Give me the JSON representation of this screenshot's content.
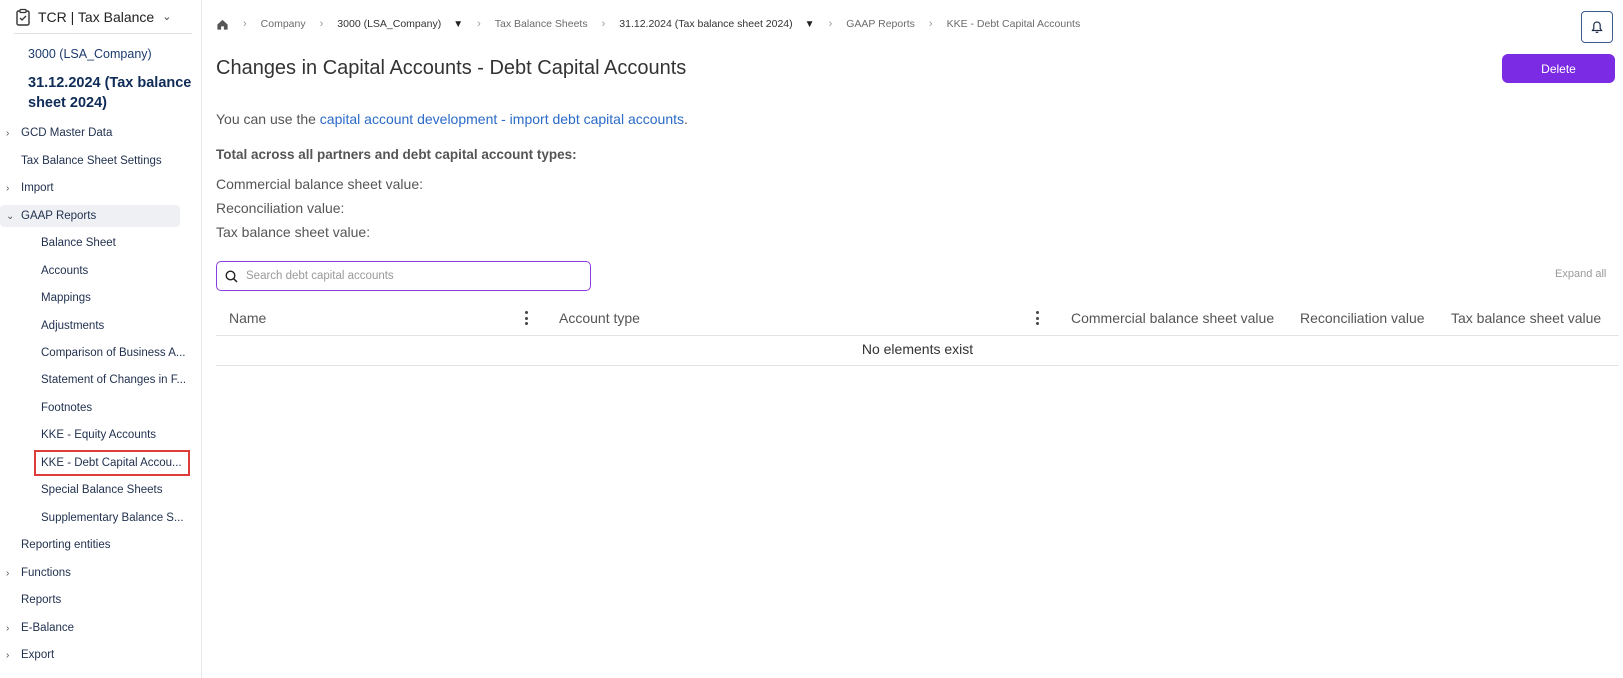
{
  "app": {
    "title": "TCR | Tax Balance"
  },
  "sidebar": {
    "company": "3000 (LSA_Company)",
    "sheet": "31.12.2024 (Tax balance sheet 2024)",
    "items": [
      {
        "label": "GCD Master Data",
        "expandable": true
      },
      {
        "label": "Tax Balance Sheet Settings",
        "expandable": false
      },
      {
        "label": "Import",
        "expandable": true
      },
      {
        "label": "GAAP Reports",
        "expandable": true,
        "expanded": true
      },
      {
        "label": "Balance Sheet"
      },
      {
        "label": "Accounts"
      },
      {
        "label": "Mappings"
      },
      {
        "label": "Adjustments"
      },
      {
        "label": "Comparison of Business A..."
      },
      {
        "label": "Statement of Changes in F..."
      },
      {
        "label": "Footnotes"
      },
      {
        "label": "KKE - Equity Accounts"
      },
      {
        "label": "KKE - Debt Capital Accou..."
      },
      {
        "label": "Special Balance Sheets"
      },
      {
        "label": "Supplementary Balance S..."
      },
      {
        "label": "Reporting entities",
        "expandable": false
      },
      {
        "label": "Functions",
        "expandable": true
      },
      {
        "label": "Reports",
        "expandable": false
      },
      {
        "label": "E-Balance",
        "expandable": true
      },
      {
        "label": "Export",
        "expandable": true
      }
    ]
  },
  "breadcrumb": {
    "items": [
      "Company",
      "3000 (LSA_Company)",
      "Tax Balance Sheets",
      "31.12.2024 (Tax balance sheet 2024)",
      "GAAP Reports",
      "KKE - Debt Capital Accounts"
    ]
  },
  "page": {
    "title": "Changes in Capital Accounts - Debt Capital Accounts",
    "delete_label": "Delete",
    "info_prefix": "You can use the ",
    "info_link": "capital account development - import debt capital accounts",
    "info_suffix": ".",
    "totals_heading": "Total across all partners and debt capital account types:",
    "commercial_label": "Commercial balance sheet value:",
    "reconciliation_label": "Reconciliation value:",
    "tax_label": "Tax balance sheet value:",
    "search_placeholder": "Search debt capital accounts",
    "expand_all": "Expand all"
  },
  "table": {
    "columns": [
      "Name",
      "Account type",
      "Commercial balance sheet value",
      "Reconciliation value",
      "Tax balance sheet value"
    ],
    "empty_text": "No elements exist"
  },
  "colors": {
    "primary_button": "#7b2be4",
    "link": "#2a6ac8",
    "selected_outline": "#e03b3b",
    "search_border": "#8a3fe0"
  }
}
